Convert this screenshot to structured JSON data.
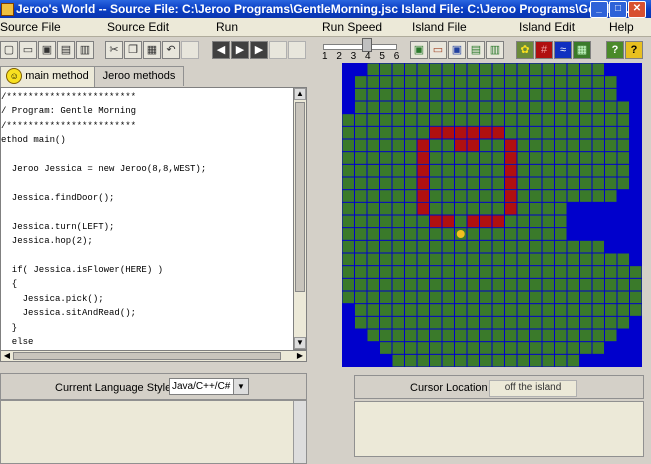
{
  "window": {
    "title": "Jeroo's World -- Source File: C:\\Jeroo Programs\\GentleMorning.jsc     Island File: C:\\Jeroo Programs\\GentleM...",
    "minimize_glyph": "_",
    "maximize_glyph": "□",
    "close_glyph": "✕"
  },
  "menu": [
    "Source File",
    "Source Edit",
    "Run",
    "Run Speed",
    "Island File",
    "Island Edit",
    "Help"
  ],
  "toolbar": {
    "source_buttons": [
      "new-file-icon",
      "open-file-icon",
      "save-icon",
      "save-as-icon",
      "print-icon"
    ],
    "edit_buttons": [
      "cut-icon",
      "copy-icon",
      "paste-icon",
      "undo-icon",
      "redo-icon"
    ],
    "run_buttons": [
      "reset-icon",
      "run-stepwise-icon",
      "run-continuous-icon",
      "pause-icon",
      "stop-icon"
    ],
    "island_buttons": [
      "new-island-icon",
      "open-island-icon",
      "save-island-icon",
      "save-island-as-icon",
      "print-island-icon"
    ],
    "island_edit_buttons": [
      "flower-icon",
      "net-icon",
      "water-icon",
      "land-icon",
      "help-icon"
    ],
    "speed_labels": "1 2 3 4 5 6",
    "speed_value": 4
  },
  "tabs": {
    "main_method": "main method",
    "jeroo_methods": "Jeroo methods"
  },
  "code": "/************************\n/ Program: Gentle Morning\n/************************\nethod main()\n\n  Jeroo Jessica = new Jeroo(8,8,WEST);\n\n  Jessica.findDoor();\n\n  Jessica.turn(LEFT);\n  Jessica.hop(2);\n\n  if( Jessica.isFlower(HERE) )\n  {\n    Jessica.pick();\n    Jessica.sitAndRead();\n  }\n  else\n  {",
  "language": {
    "label": "Current Language Style",
    "value": "Java/C++/C#"
  },
  "cursor": {
    "label": "Cursor Location",
    "value": "off the island"
  },
  "colors": {
    "water": "#0000cc",
    "land": "#3a7a2a",
    "net": "#b01010",
    "flower": "#f0c020"
  }
}
